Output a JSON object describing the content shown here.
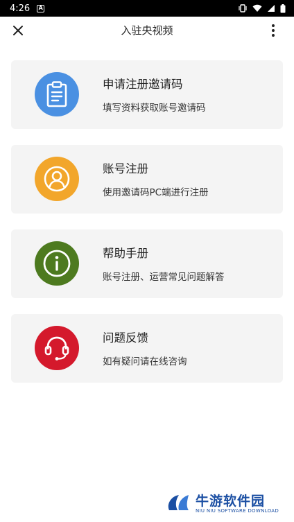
{
  "status_bar": {
    "time": "4:26",
    "notification_icon": "A"
  },
  "app_bar": {
    "title": "入驻央视频",
    "close_icon": "close-icon",
    "more_icon": "more-vertical-icon"
  },
  "cards": [
    {
      "title": "申请注册邀请码",
      "subtitle": "填写资料获取账号邀请码",
      "icon": "clipboard-icon",
      "color": "#4a90e2"
    },
    {
      "title": "账号注册",
      "subtitle": "使用邀请码PC端进行注册",
      "icon": "user-icon",
      "color": "#f2a62b"
    },
    {
      "title": "帮助手册",
      "subtitle": "账号注册、运营常见问题解答",
      "icon": "info-icon",
      "color": "#4d7a1f"
    },
    {
      "title": "问题反馈",
      "subtitle": "如有疑问请在线咨询",
      "icon": "headset-icon",
      "color": "#d4192c"
    }
  ],
  "watermark": {
    "name": "牛游软件园",
    "sub": "NIU NIU SOFTWARE DOWNLOAD"
  }
}
